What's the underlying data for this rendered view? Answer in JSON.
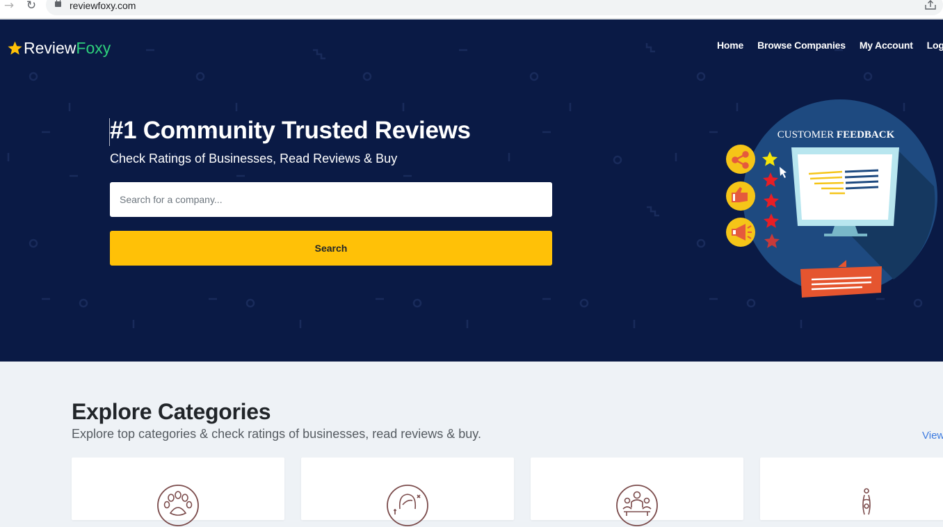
{
  "browser": {
    "url": "reviewfoxy.com",
    "back_icon": "arrow-right-icon",
    "reload_icon": "reload-icon",
    "share_icon": "share-icon"
  },
  "header": {
    "logo_part1": "Review",
    "logo_part2": "Foxy",
    "nav": [
      {
        "label": "Home"
      },
      {
        "label": "Browse Companies"
      },
      {
        "label": "My Account"
      },
      {
        "label": "Logout"
      }
    ]
  },
  "hero": {
    "title": "#1 Community Trusted Reviews",
    "subtitle": "Check Ratings of Businesses, Read Reviews & Buy",
    "search_placeholder": "Search for a company...",
    "search_button": "Search",
    "illustration_caption": "CUSTOMER FEEDBACK",
    "illustration_caption_bold": "FEEDBACK",
    "colors": {
      "background": "#0a1a45",
      "accent": "#ffc107",
      "brand_green": "#2ed17c"
    }
  },
  "categories": {
    "title": "Explore Categories",
    "subtitle": "Explore top categories & check ratings of businesses, read reviews & buy.",
    "view_all": "View",
    "cards": [
      {
        "icon": "paw-icon"
      },
      {
        "icon": "beauty-icon"
      },
      {
        "icon": "business-people-icon"
      },
      {
        "icon": "figure-icon"
      }
    ]
  }
}
